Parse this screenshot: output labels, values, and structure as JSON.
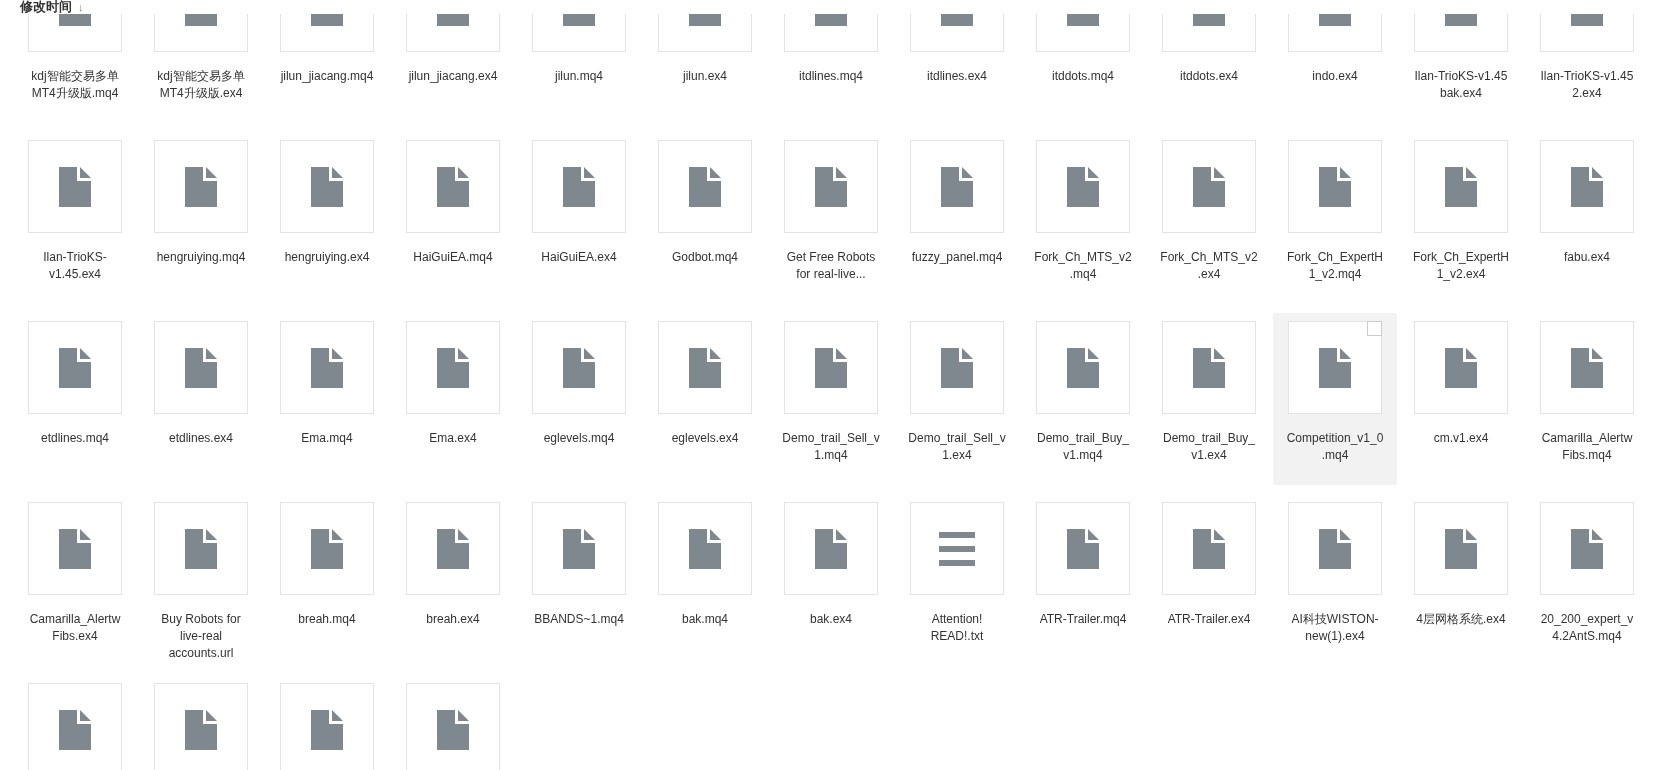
{
  "sort_header": {
    "label": "修改时间",
    "arrow": "↓"
  },
  "files": [
    {
      "name": "kdj智能交易多单MT4升级版.mq4",
      "kind": "file",
      "highlighted": false,
      "checked": false
    },
    {
      "name": "kdj智能交易多单MT4升级版.ex4",
      "kind": "file",
      "highlighted": false,
      "checked": false
    },
    {
      "name": "jilun_jiacang.mq4",
      "kind": "file",
      "highlighted": false,
      "checked": false
    },
    {
      "name": "jilun_jiacang.ex4",
      "kind": "file",
      "highlighted": false,
      "checked": false
    },
    {
      "name": "jilun.mq4",
      "kind": "file",
      "highlighted": false,
      "checked": false
    },
    {
      "name": "jilun.ex4",
      "kind": "file",
      "highlighted": false,
      "checked": false
    },
    {
      "name": "itdlines.mq4",
      "kind": "file",
      "highlighted": false,
      "checked": false
    },
    {
      "name": "itdlines.ex4",
      "kind": "file",
      "highlighted": false,
      "checked": false
    },
    {
      "name": "itddots.mq4",
      "kind": "file",
      "highlighted": false,
      "checked": false
    },
    {
      "name": "itddots.ex4",
      "kind": "file",
      "highlighted": false,
      "checked": false
    },
    {
      "name": "indo.ex4",
      "kind": "file",
      "highlighted": false,
      "checked": false
    },
    {
      "name": "Ilan-TrioKS-v1.45 bak.ex4",
      "kind": "file",
      "highlighted": false,
      "checked": false
    },
    {
      "name": "Ilan-TrioKS-v1.45 2.ex4",
      "kind": "file",
      "highlighted": false,
      "checked": false
    },
    {
      "name": "Ilan-TrioKS-v1.45.ex4",
      "kind": "file",
      "highlighted": false,
      "checked": false
    },
    {
      "name": "hengruiying.mq4",
      "kind": "file",
      "highlighted": false,
      "checked": false
    },
    {
      "name": "hengruiying.ex4",
      "kind": "file",
      "highlighted": false,
      "checked": false
    },
    {
      "name": "HaiGuiEA.mq4",
      "kind": "file",
      "highlighted": false,
      "checked": false
    },
    {
      "name": "HaiGuiEA.ex4",
      "kind": "file",
      "highlighted": false,
      "checked": false
    },
    {
      "name": "Godbot.mq4",
      "kind": "file",
      "highlighted": false,
      "checked": false
    },
    {
      "name": "Get Free Robots for real-live...",
      "kind": "file",
      "highlighted": false,
      "checked": false
    },
    {
      "name": "fuzzy_panel.mq4",
      "kind": "file",
      "highlighted": false,
      "checked": false
    },
    {
      "name": "Fork_Ch_MTS_v2.mq4",
      "kind": "file",
      "highlighted": false,
      "checked": false
    },
    {
      "name": "Fork_Ch_MTS_v2.ex4",
      "kind": "file",
      "highlighted": false,
      "checked": false
    },
    {
      "name": "Fork_Ch_ExpertH1_v2.mq4",
      "kind": "file",
      "highlighted": false,
      "checked": false
    },
    {
      "name": "Fork_Ch_ExpertH1_v2.ex4",
      "kind": "file",
      "highlighted": false,
      "checked": false
    },
    {
      "name": "fabu.ex4",
      "kind": "file",
      "highlighted": false,
      "checked": false
    },
    {
      "name": "etdlines.mq4",
      "kind": "file",
      "highlighted": false,
      "checked": false
    },
    {
      "name": "etdlines.ex4",
      "kind": "file",
      "highlighted": false,
      "checked": false
    },
    {
      "name": "Ema.mq4",
      "kind": "file",
      "highlighted": false,
      "checked": false
    },
    {
      "name": "Ema.ex4",
      "kind": "file",
      "highlighted": false,
      "checked": false
    },
    {
      "name": "eglevels.mq4",
      "kind": "file",
      "highlighted": false,
      "checked": false
    },
    {
      "name": "eglevels.ex4",
      "kind": "file",
      "highlighted": false,
      "checked": false
    },
    {
      "name": "Demo_trail_Sell_v1.mq4",
      "kind": "file",
      "highlighted": false,
      "checked": false
    },
    {
      "name": "Demo_trail_Sell_v1.ex4",
      "kind": "file",
      "highlighted": false,
      "checked": false
    },
    {
      "name": "Demo_trail_Buy_v1.mq4",
      "kind": "file",
      "highlighted": false,
      "checked": false
    },
    {
      "name": "Demo_trail_Buy_v1.ex4",
      "kind": "file",
      "highlighted": false,
      "checked": false
    },
    {
      "name": "Competition_v1_0.mq4",
      "kind": "file",
      "highlighted": true,
      "checked": false
    },
    {
      "name": "cm.v1.ex4",
      "kind": "file",
      "highlighted": false,
      "checked": false
    },
    {
      "name": "Camarilla_AlertwFibs.mq4",
      "kind": "file",
      "highlighted": false,
      "checked": false
    },
    {
      "name": "Camarilla_AlertwFibs.ex4",
      "kind": "file",
      "highlighted": false,
      "checked": false
    },
    {
      "name": "Buy Robots for live-real accounts.url",
      "kind": "file",
      "highlighted": false,
      "checked": false
    },
    {
      "name": "breah.mq4",
      "kind": "file",
      "highlighted": false,
      "checked": false
    },
    {
      "name": "breah.ex4",
      "kind": "file",
      "highlighted": false,
      "checked": false
    },
    {
      "name": "BBANDS~1.mq4",
      "kind": "file",
      "highlighted": false,
      "checked": false
    },
    {
      "name": "bak.mq4",
      "kind": "file",
      "highlighted": false,
      "checked": false
    },
    {
      "name": "bak.ex4",
      "kind": "file",
      "highlighted": false,
      "checked": false
    },
    {
      "name": "Attention! READ!.txt",
      "kind": "text",
      "highlighted": false,
      "checked": false
    },
    {
      "name": "ATR-Trailer.mq4",
      "kind": "file",
      "highlighted": false,
      "checked": false
    },
    {
      "name": "ATR-Trailer.ex4",
      "kind": "file",
      "highlighted": false,
      "checked": false
    },
    {
      "name": "AI科技WISTON-new(1).ex4",
      "kind": "file",
      "highlighted": false,
      "checked": false
    },
    {
      "name": "4层网格系统.ex4",
      "kind": "file",
      "highlighted": false,
      "checked": false
    },
    {
      "name": "20_200_expert_v4.2AntS.mq4",
      "kind": "file",
      "highlighted": false,
      "checked": false
    },
    {
      "kind": "file",
      "highlighted": false,
      "checked": false
    },
    {
      "kind": "file",
      "highlighted": false,
      "checked": false
    },
    {
      "kind": "file",
      "highlighted": false,
      "checked": false
    },
    {
      "kind": "file",
      "highlighted": false,
      "checked": false
    }
  ]
}
